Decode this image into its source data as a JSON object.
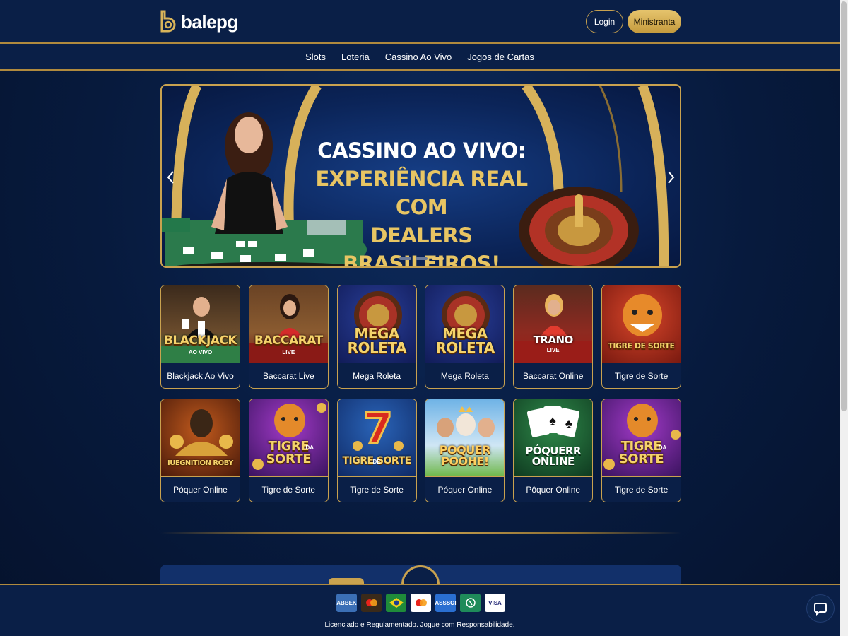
{
  "header": {
    "brand": "balepg",
    "login_label": "Login",
    "register_label": "Ministranta"
  },
  "nav": {
    "items": [
      "Slots",
      "Loteria",
      "Cassino Ao Vivo",
      "Jogos de Cartas"
    ]
  },
  "banner": {
    "line1": "CASSINO AO VIVO:",
    "line2": "EXPERIÊNCIA REAL COM",
    "line3": "DEALERS BRASILEIROS!",
    "slide_count": 3,
    "active_slide": 3
  },
  "games": [
    {
      "label": "Blackjack Ao Vivo",
      "art_title": "BLACKJACK",
      "art_sub": "AO VIVO"
    },
    {
      "label": "Baccarat Live",
      "art_title": "BACCARAT",
      "art_sub": "LIVE"
    },
    {
      "label": "Mega Roleta",
      "art_title": "MEGA ROLETA",
      "art_sub": ""
    },
    {
      "label": "Mega Roleta",
      "art_title": "MEGA ROLETA",
      "art_sub": ""
    },
    {
      "label": "Baccarat Online",
      "art_title": "TRANO",
      "art_sub": "LIVE"
    },
    {
      "label": "Tigre de Sorte",
      "art_title": "TIGRE DE SORTE",
      "art_sub": ""
    },
    {
      "label": "Póquer Online",
      "art_title": "IUEGNITION ROBY",
      "art_sub": ""
    },
    {
      "label": "Tigre de Sorte",
      "art_title": "TIGRE SORTE",
      "art_sub": "DA"
    },
    {
      "label": "Tigre de Sorte",
      "art_title": "TIGRE SORTE",
      "art_sub": "DE"
    },
    {
      "label": "Póquer Online",
      "art_title": "POQUER POOHE!",
      "art_sub": ""
    },
    {
      "label": "Pôquer Online",
      "art_title": "PÓQUERR ONLINE",
      "art_sub": ""
    },
    {
      "label": "Tigre de Sorte",
      "art_title": "TIGRE SORTE",
      "art_sub": "DA"
    }
  ],
  "footer": {
    "payments": [
      {
        "name": "ABBEK",
        "color": "#3b6fb6"
      },
      {
        "name": "",
        "color": "#3a2a1a"
      },
      {
        "name": "",
        "color": "#1f8b3a"
      },
      {
        "name": "",
        "color": "#ffffff"
      },
      {
        "name": "ASSSOI",
        "color": "#2a6fd1"
      },
      {
        "name": "",
        "color": "#1f8b5a"
      },
      {
        "name": "VISA",
        "color": "#ffffff"
      }
    ],
    "disclaimer": "Licenciado e Regulamentado. Jogue com Responsabilidade."
  },
  "colors": {
    "gold": "#c9a24f",
    "navy": "#0a1f47",
    "background": "#071a3d"
  }
}
